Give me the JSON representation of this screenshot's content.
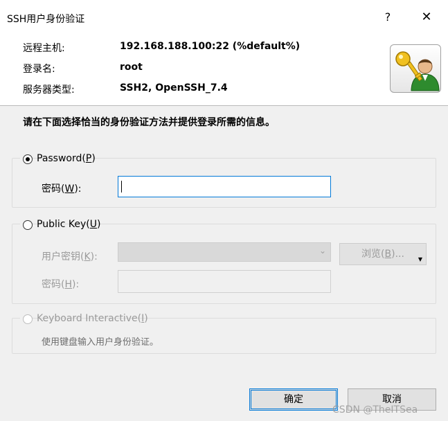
{
  "window": {
    "title": "SSH用户身份验证",
    "help_label": "?",
    "close_label": "✕"
  },
  "info": {
    "remote_host_label": "远程主机:",
    "remote_host_value": "192.168.188.100:22 (%default%)",
    "login_label": "登录名:",
    "login_value": "root",
    "server_type_label": "服务器类型:",
    "server_type_value": "SSH2, OpenSSH_7.4",
    "logo_icon": "user-key-icon"
  },
  "instruction": "请在下面选择恰当的身份验证方法并提供登录所需的信息。",
  "password_group": {
    "radio_text": "Password(",
    "radio_mnemonic": "P",
    "radio_suffix": ")",
    "checked": true,
    "field_label": "密码(",
    "field_mnemonic": "W",
    "field_suffix": "):",
    "value": ""
  },
  "public_key_group": {
    "radio_text": "Public Key(",
    "radio_mnemonic": "U",
    "radio_suffix": ")",
    "checked": false,
    "key_label": "用户密钥(",
    "key_mnemonic": "K",
    "key_suffix": "):",
    "key_value": "",
    "passphrase_label": "密码(",
    "passphrase_mnemonic": "H",
    "passphrase_suffix": "):",
    "browse_label": "浏览(",
    "browse_mnemonic": "B",
    "browse_suffix": ")..."
  },
  "keyboard_group": {
    "radio_text": "Keyboard Interactive(",
    "radio_mnemonic": "I",
    "radio_suffix": ")",
    "checked": false,
    "hint": "使用键盘输入用户身份验证。"
  },
  "buttons": {
    "ok": "确定",
    "cancel": "取消"
  },
  "watermark": "CSDN @TheITSea"
}
